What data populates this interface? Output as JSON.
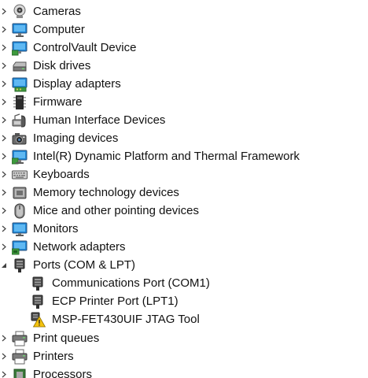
{
  "device_tree": {
    "categories": [
      {
        "label": "Cameras",
        "icon": "camera-icon"
      },
      {
        "label": "Computer",
        "icon": "computer-icon"
      },
      {
        "label": "ControlVault Device",
        "icon": "controlvault-icon"
      },
      {
        "label": "Disk drives",
        "icon": "disk-drive-icon"
      },
      {
        "label": "Display adapters",
        "icon": "display-adapter-icon"
      },
      {
        "label": "Firmware",
        "icon": "firmware-icon"
      },
      {
        "label": "Human Interface Devices",
        "icon": "hid-icon"
      },
      {
        "label": "Imaging devices",
        "icon": "imaging-device-icon"
      },
      {
        "label": "Intel(R) Dynamic Platform and Thermal Framework",
        "icon": "intel-dptf-icon"
      },
      {
        "label": "Keyboards",
        "icon": "keyboard-icon"
      },
      {
        "label": "Memory technology devices",
        "icon": "memory-device-icon"
      },
      {
        "label": "Mice and other pointing devices",
        "icon": "mouse-icon"
      },
      {
        "label": "Monitors",
        "icon": "monitor-icon"
      },
      {
        "label": "Network adapters",
        "icon": "network-adapter-icon"
      },
      {
        "label": "Ports (COM & LPT)",
        "icon": "port-icon",
        "expanded": true
      },
      {
        "label": "Print queues",
        "icon": "print-queue-icon"
      },
      {
        "label": "Printers",
        "icon": "printer-icon"
      },
      {
        "label": "Processors",
        "icon": "processor-icon"
      }
    ],
    "ports_children": [
      {
        "label": "Communications Port (COM1)",
        "icon": "port-icon"
      },
      {
        "label": "ECP Printer Port (LPT1)",
        "icon": "port-icon"
      },
      {
        "label": "MSP-FET430UIF JTAG Tool",
        "icon": "warning-icon",
        "status": "warning"
      }
    ]
  },
  "colors": {
    "text": "#111111",
    "toggle": "#404040",
    "monitor_blue": "#1e88d8",
    "warning_yellow": "#f4c20d"
  }
}
